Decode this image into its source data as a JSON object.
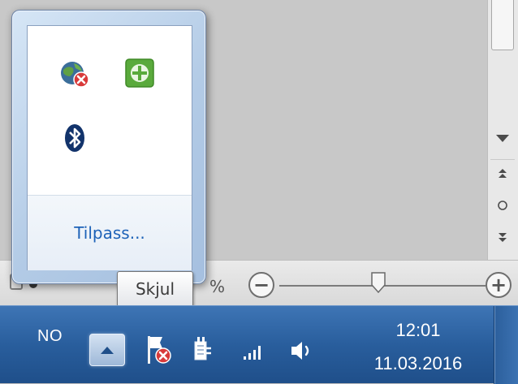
{
  "tray_popup": {
    "customize_label": "Tilpass...",
    "icons": [
      {
        "name": "network-error-globe-icon"
      },
      {
        "name": "green-plus-shield-icon"
      },
      {
        "name": "bluetooth-icon"
      }
    ]
  },
  "tooltip": {
    "text": "Skjul"
  },
  "statusbar": {
    "zoom_suffix": "%",
    "zoom_out_label": "−",
    "zoom_in_label": "+"
  },
  "taskbar": {
    "language": "NO",
    "clock": {
      "time": "12:01",
      "date": "11.03.2016"
    },
    "icons": [
      {
        "name": "show-hidden-icons-arrow-icon"
      },
      {
        "name": "action-center-flag-error-icon"
      },
      {
        "name": "power-plug-icon"
      },
      {
        "name": "network-signal-icon"
      },
      {
        "name": "volume-speaker-icon"
      }
    ]
  },
  "colors": {
    "taskbar_blue": "#295e9d",
    "link_blue": "#1d62b8",
    "error_red": "#d83a3a",
    "tray_green": "#5aaa3c"
  }
}
